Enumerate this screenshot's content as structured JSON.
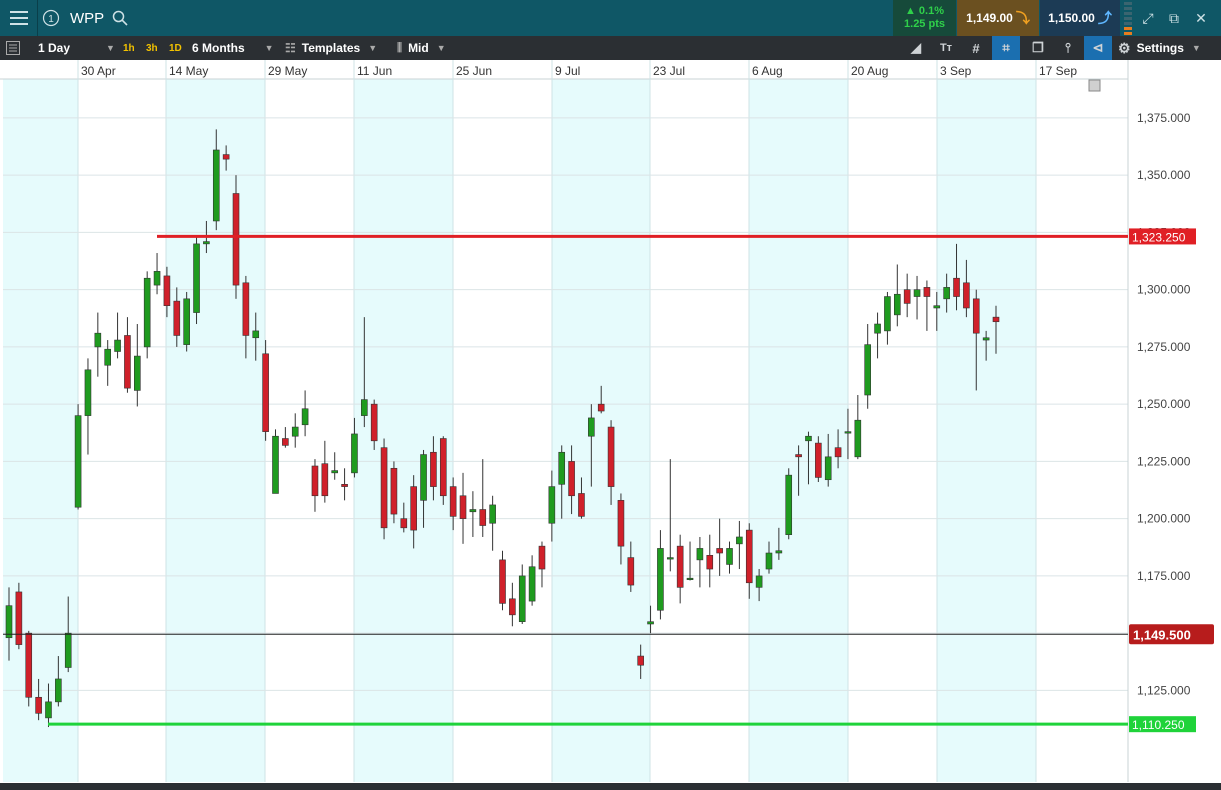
{
  "header": {
    "symbol": "WPP",
    "change_pct": "▲ 0.1%",
    "change_pts": "1.25 pts",
    "sell_price": "1,149.00",
    "buy_price": "1,150.00"
  },
  "toolbar": {
    "interval": "1 Day",
    "quick_intervals": [
      "1h",
      "3h",
      "1D"
    ],
    "range": "6 Months",
    "templates": "Templates",
    "price_type": "Mid",
    "settings": "Settings"
  },
  "icons": {
    "menu": "hamburger-icon",
    "info": "circle-one-icon",
    "search": "search-icon",
    "sell_arrow": "arrow-down-icon",
    "buy_arrow": "arrow-up-icon",
    "expand": "expand-icon",
    "popout": "external-link-icon",
    "close": "close-icon"
  },
  "colors": {
    "up": "#1f9b1f",
    "down": "#d0202a",
    "resistance": "#e01f25",
    "support": "#1fd33a",
    "band": "#e6fbfc",
    "last_price": "#b71c1c"
  },
  "chart_data": {
    "type": "candlestick",
    "x_labels": [
      "30 Apr",
      "14 May",
      "29 May",
      "11 Jun",
      "25 Jun",
      "9 Jul",
      "23 Jul",
      "6 Aug",
      "20 Aug",
      "3 Sep",
      "17 Sep"
    ],
    "y_ticks": [
      "1,125.000",
      "1,150.000",
      "1,175.000",
      "1,200.000",
      "1,225.000",
      "1,250.000",
      "1,275.000",
      "1,300.000",
      "1,325.000",
      "1,350.000",
      "1,375.000"
    ],
    "y_tick_values": [
      1125,
      1150,
      1175,
      1200,
      1225,
      1250,
      1275,
      1300,
      1325,
      1350,
      1375
    ],
    "ylim": [
      1085,
      1392
    ],
    "grid": true,
    "last_price": 1149.5,
    "last_price_label": "1,149.500",
    "resistance": 1323.25,
    "resistance_label": "1,323.250",
    "support": 1110.25,
    "support_label": "1,110.250",
    "candles": [
      [
        1148,
        1162,
        1170,
        1138
      ],
      [
        1168,
        1145,
        1172,
        1143
      ],
      [
        1150,
        1122,
        1151,
        1118
      ],
      [
        1122,
        1115,
        1130,
        1112
      ],
      [
        1113,
        1120,
        1128,
        1109
      ],
      [
        1120,
        1130,
        1140,
        1118
      ],
      [
        1135,
        1150,
        1166,
        1133
      ],
      [
        1205,
        1245,
        1250,
        1204
      ],
      [
        1245,
        1265,
        1270,
        1228
      ],
      [
        1275,
        1281,
        1290,
        1262
      ],
      [
        1267,
        1274,
        1278,
        1258
      ],
      [
        1273,
        1278,
        1290,
        1270
      ],
      [
        1280,
        1257,
        1288,
        1255
      ],
      [
        1256,
        1271,
        1285,
        1249
      ],
      [
        1275,
        1305,
        1308,
        1270
      ],
      [
        1302,
        1308,
        1316,
        1298
      ],
      [
        1306,
        1293,
        1310,
        1288
      ],
      [
        1295,
        1280,
        1301,
        1275
      ],
      [
        1276,
        1296,
        1299,
        1273
      ],
      [
        1290,
        1320,
        1323,
        1285
      ],
      [
        1320,
        1321,
        1330,
        1316
      ],
      [
        1330,
        1361,
        1370,
        1326
      ],
      [
        1359,
        1357,
        1363,
        1352
      ],
      [
        1342,
        1302,
        1350,
        1296
      ],
      [
        1303,
        1280,
        1306,
        1270
      ],
      [
        1279,
        1282,
        1290,
        1269
      ],
      [
        1272,
        1238,
        1278,
        1234
      ],
      [
        1211,
        1236,
        1239,
        1212
      ],
      [
        1235,
        1232,
        1240,
        1231
      ],
      [
        1236,
        1240,
        1246,
        1231
      ],
      [
        1241,
        1248,
        1256,
        1236
      ],
      [
        1223,
        1210,
        1226,
        1203
      ],
      [
        1224,
        1210,
        1234,
        1207
      ],
      [
        1220,
        1221,
        1229,
        1217
      ],
      [
        1215,
        1214,
        1222,
        1208
      ],
      [
        1220,
        1237,
        1244,
        1218
      ],
      [
        1245,
        1252,
        1288,
        1240
      ],
      [
        1250,
        1234,
        1252,
        1230
      ],
      [
        1231,
        1196,
        1235,
        1191
      ],
      [
        1222,
        1202,
        1225,
        1198
      ],
      [
        1200,
        1196,
        1207,
        1194
      ],
      [
        1214,
        1195,
        1219,
        1187
      ],
      [
        1208,
        1228,
        1230,
        1196
      ],
      [
        1229,
        1214,
        1236,
        1208
      ],
      [
        1235,
        1210,
        1236,
        1206
      ],
      [
        1214,
        1201,
        1218,
        1195
      ],
      [
        1210,
        1200,
        1220,
        1189
      ],
      [
        1203,
        1204,
        1212,
        1192
      ],
      [
        1204,
        1197,
        1226,
        1192
      ],
      [
        1198,
        1206,
        1210,
        1186
      ],
      [
        1182,
        1163,
        1186,
        1160
      ],
      [
        1165,
        1158,
        1172,
        1153
      ],
      [
        1155,
        1175,
        1180,
        1154
      ],
      [
        1164,
        1179,
        1184,
        1162
      ],
      [
        1188,
        1178,
        1190,
        1170
      ],
      [
        1198,
        1214,
        1221,
        1190
      ],
      [
        1215,
        1229,
        1232,
        1200
      ],
      [
        1225,
        1210,
        1232,
        1202
      ],
      [
        1211,
        1201,
        1218,
        1200
      ],
      [
        1236,
        1244,
        1250,
        1214
      ],
      [
        1250,
        1247,
        1258,
        1246
      ],
      [
        1240,
        1214,
        1243,
        1206
      ],
      [
        1208,
        1188,
        1211,
        1180
      ],
      [
        1183,
        1171,
        1190,
        1168
      ],
      [
        1140,
        1136,
        1145,
        1130
      ],
      [
        1154,
        1155,
        1162,
        1150
      ],
      [
        1160,
        1187,
        1195,
        1156
      ],
      [
        1183,
        1183,
        1226,
        1177
      ],
      [
        1188,
        1170,
        1193,
        1163
      ],
      [
        1174,
        1174,
        1190,
        1173
      ],
      [
        1182,
        1187,
        1192,
        1170
      ],
      [
        1184,
        1178,
        1193,
        1170
      ],
      [
        1187,
        1185,
        1200,
        1175
      ],
      [
        1180,
        1187,
        1190,
        1176
      ],
      [
        1189,
        1192,
        1199,
        1178
      ],
      [
        1195,
        1172,
        1198,
        1165
      ],
      [
        1170,
        1175,
        1178,
        1164
      ],
      [
        1178,
        1185,
        1190,
        1176
      ],
      [
        1185,
        1186,
        1196,
        1182
      ],
      [
        1193,
        1219,
        1222,
        1191
      ],
      [
        1228,
        1227,
        1232,
        1210
      ],
      [
        1234,
        1236,
        1238,
        1215
      ],
      [
        1233,
        1218,
        1236,
        1216
      ],
      [
        1217,
        1227,
        1237,
        1214
      ],
      [
        1231,
        1227,
        1239,
        1222
      ],
      [
        1238,
        1238,
        1248,
        1226
      ],
      [
        1227,
        1243,
        1254,
        1226
      ],
      [
        1254,
        1276,
        1285,
        1248
      ],
      [
        1281,
        1285,
        1290,
        1270
      ],
      [
        1282,
        1297,
        1299,
        1276
      ],
      [
        1289,
        1298,
        1311,
        1284
      ],
      [
        1300,
        1294,
        1307,
        1288
      ],
      [
        1297,
        1300,
        1306,
        1287
      ],
      [
        1301,
        1297,
        1304,
        1282
      ],
      [
        1292,
        1293,
        1299,
        1282
      ],
      [
        1296,
        1301,
        1307,
        1290
      ],
      [
        1305,
        1297,
        1320,
        1291
      ],
      [
        1303,
        1292,
        1313,
        1288
      ],
      [
        1296,
        1281,
        1300,
        1256
      ],
      [
        1278,
        1279,
        1282,
        1269
      ],
      [
        1288,
        1286,
        1293,
        1272
      ]
    ]
  }
}
